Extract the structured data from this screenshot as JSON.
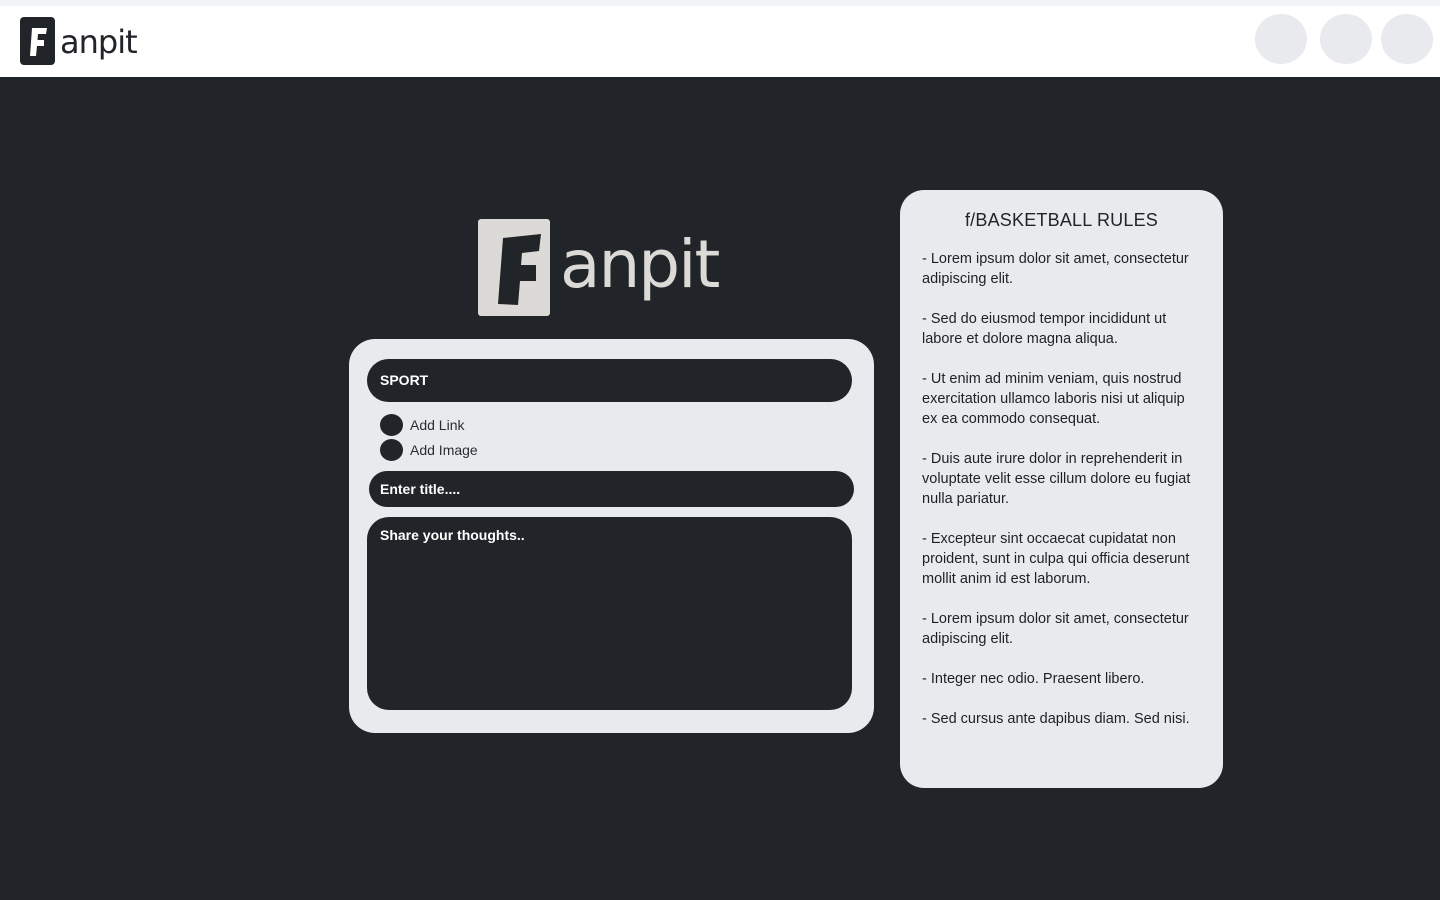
{
  "brand": {
    "name": "anpit"
  },
  "header": {
    "buttons": [
      "",
      "",
      ""
    ]
  },
  "post_form": {
    "community": "SPORT",
    "options": [
      "Add Link",
      "Add Image"
    ],
    "title_placeholder": "Enter title....",
    "body_placeholder": "Share your thoughts.."
  },
  "rules": {
    "title": "f/BASKETBALL RULES",
    "items": [
      "- Lorem ipsum dolor sit amet, consectetur adipiscing elit.",
      "- Sed do eiusmod tempor incididunt ut labore et dolore magna aliqua.",
      "- Ut enim ad minim veniam, quis nostrud exercitation ullamco laboris nisi ut aliquip ex ea commodo consequat.",
      "- Duis aute irure dolor in reprehenderit in voluptate velit esse cillum dolore eu fugiat nulla pariatur.",
      "- Excepteur sint occaecat cupidatat non proident, sunt in culpa qui officia deserunt mollit anim id est laborum.",
      "- Lorem ipsum dolor sit amet, consectetur adipiscing elit.",
      "- Integer nec odio. Praesent libero.",
      "- Sed cursus ante dapibus diam. Sed nisi."
    ]
  },
  "colors": {
    "background": "#212428",
    "card": "#e8ebee",
    "logo_light": "#dcdad6",
    "logo_dark": "#212428"
  }
}
